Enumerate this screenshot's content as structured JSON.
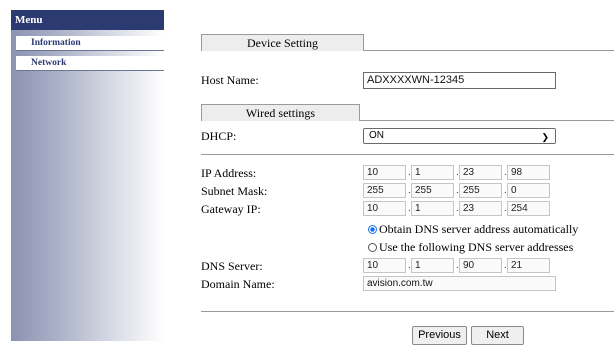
{
  "sidebar": {
    "header": "Menu",
    "items": [
      {
        "label": "Information"
      },
      {
        "label": "Network"
      }
    ]
  },
  "device_setting": {
    "tab_label": "Device Setting",
    "host_name_label": "Host Name:",
    "host_name_value": "ADXXXXWN-12345"
  },
  "wired_settings": {
    "tab_label": "Wired settings",
    "dhcp_label": "DHCP:",
    "dhcp_value": "ON",
    "ip_label": "IP Address:",
    "ip": [
      "10",
      "1",
      "23",
      "98"
    ],
    "subnet_label": "Subnet Mask:",
    "subnet": [
      "255",
      "255",
      "255",
      "0"
    ],
    "gateway_label": "Gateway IP:",
    "gateway": [
      "10",
      "1",
      "23",
      "254"
    ],
    "dns_auto_label": "Obtain DNS server address automatically",
    "dns_manual_label": "Use the following DNS server addresses",
    "dns_mode": "auto",
    "dns_label": "DNS Server:",
    "dns": [
      "10",
      "1",
      "90",
      "21"
    ],
    "domain_label": "Domain Name:",
    "domain_value": "avision.com.tw"
  },
  "buttons": {
    "previous": "Previous",
    "next": "Next"
  }
}
